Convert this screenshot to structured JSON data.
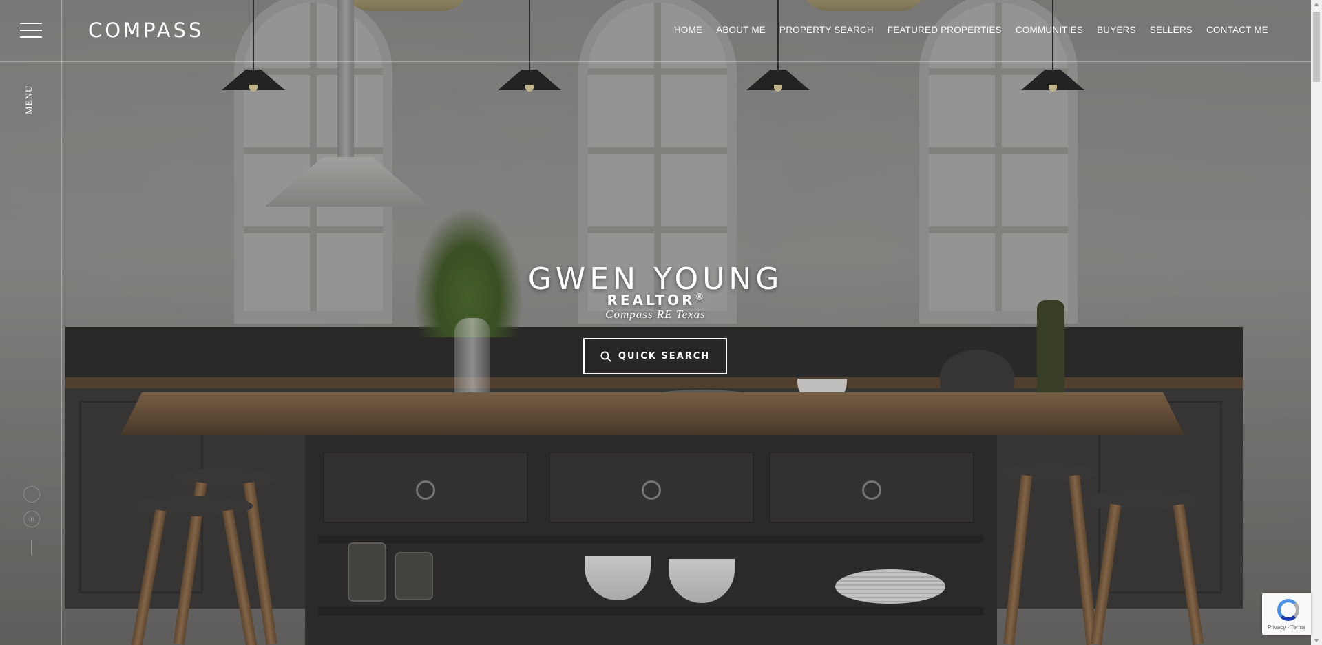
{
  "brand": {
    "logo_text": "COMPASS"
  },
  "sidebar": {
    "menu_label": "MENU"
  },
  "nav": {
    "items": [
      {
        "label": "HOME"
      },
      {
        "label": "ABOUT ME"
      },
      {
        "label": "PROPERTY SEARCH"
      },
      {
        "label": "FEATURED PROPERTIES"
      },
      {
        "label": "COMMUNITIES"
      },
      {
        "label": "BUYERS"
      },
      {
        "label": "SELLERS"
      },
      {
        "label": "CONTACT ME"
      }
    ]
  },
  "hero": {
    "name": "GWEN YOUNG",
    "title": "REALTOR",
    "title_mark": "®",
    "company": "Compass RE Texas",
    "quick_search_label": "QUICK SEARCH"
  },
  "social": {
    "icons": [
      "facebook-icon",
      "linkedin-icon"
    ],
    "linkedin_glyph": "in"
  },
  "recaptcha": {
    "terms": "Privacy - Terms"
  },
  "colors": {
    "text": "#ffffff",
    "rule": "rgba(255,255,255,0.35)",
    "scrollbar_track": "#f1f1f1",
    "scrollbar_thumb": "#c1c1c1"
  },
  "scroll": {
    "position_fraction": 0
  }
}
